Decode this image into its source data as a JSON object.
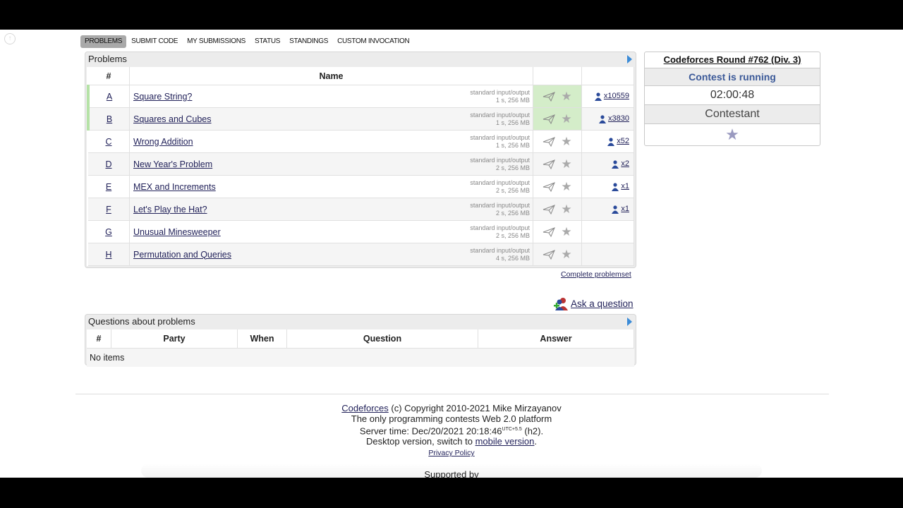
{
  "menu": [
    "PROBLEMS",
    "SUBMIT CODE",
    "MY SUBMISSIONS",
    "STATUS",
    "STANDINGS",
    "CUSTOM INVOCATION"
  ],
  "problems_box": {
    "caption": "Problems",
    "headers": {
      "id": "#",
      "name": "Name"
    },
    "rows": [
      {
        "id": "A",
        "name": "Square String?",
        "io": "standard input/output",
        "limits": "1 s, 256 MB",
        "solved": "x10559",
        "accepted": true
      },
      {
        "id": "B",
        "name": "Squares and Cubes",
        "io": "standard input/output",
        "limits": "1 s, 256 MB",
        "solved": "x3830",
        "accepted": true
      },
      {
        "id": "C",
        "name": "Wrong Addition",
        "io": "standard input/output",
        "limits": "1 s, 256 MB",
        "solved": "x52",
        "accepted": false
      },
      {
        "id": "D",
        "name": "New Year's Problem",
        "io": "standard input/output",
        "limits": "2 s, 256 MB",
        "solved": "x2",
        "accepted": false
      },
      {
        "id": "E",
        "name": "MEX and Increments",
        "io": "standard input/output",
        "limits": "2 s, 256 MB",
        "solved": "x1",
        "accepted": false
      },
      {
        "id": "F",
        "name": "Let's Play the Hat?",
        "io": "standard input/output",
        "limits": "2 s, 256 MB",
        "solved": "x1",
        "accepted": false
      },
      {
        "id": "G",
        "name": "Unusual Minesweeper",
        "io": "standard input/output",
        "limits": "2 s, 256 MB",
        "solved": "",
        "accepted": false
      },
      {
        "id": "H",
        "name": "Permutation and Queries",
        "io": "standard input/output",
        "limits": "4 s, 256 MB",
        "solved": "",
        "accepted": false
      }
    ],
    "complete_link": "Complete problemset"
  },
  "ask": {
    "label": "Ask a question"
  },
  "questions_box": {
    "caption": "Questions about problems",
    "headers": [
      "#",
      "Party",
      "When",
      "Question",
      "Answer"
    ],
    "empty": "No items"
  },
  "sidebar": {
    "contest_title": "Codeforces Round #762 (Div. 3)",
    "status": "Contest is running",
    "timer": "02:00:48",
    "role": "Contestant"
  },
  "footer": {
    "site": "Codeforces",
    "copyright": " (c) Copyright 2010-2021 Mike Mirzayanov",
    "tagline": "The only programming contests Web 2.0 platform",
    "server_time_prefix": "Server time: Dec/20/2021 20:18:46",
    "utc": "UTC+5.5",
    "server_time_suffix": " (h2).",
    "desktop_prefix": "Desktop version, switch to ",
    "mobile_link": "mobile version",
    "desktop_suffix": ".",
    "privacy": "Privacy Policy",
    "supported": "Supported by"
  },
  "colors": {
    "accent_green": "#d4edc9",
    "link": "#22225a",
    "status_blue": "#3b5998"
  }
}
